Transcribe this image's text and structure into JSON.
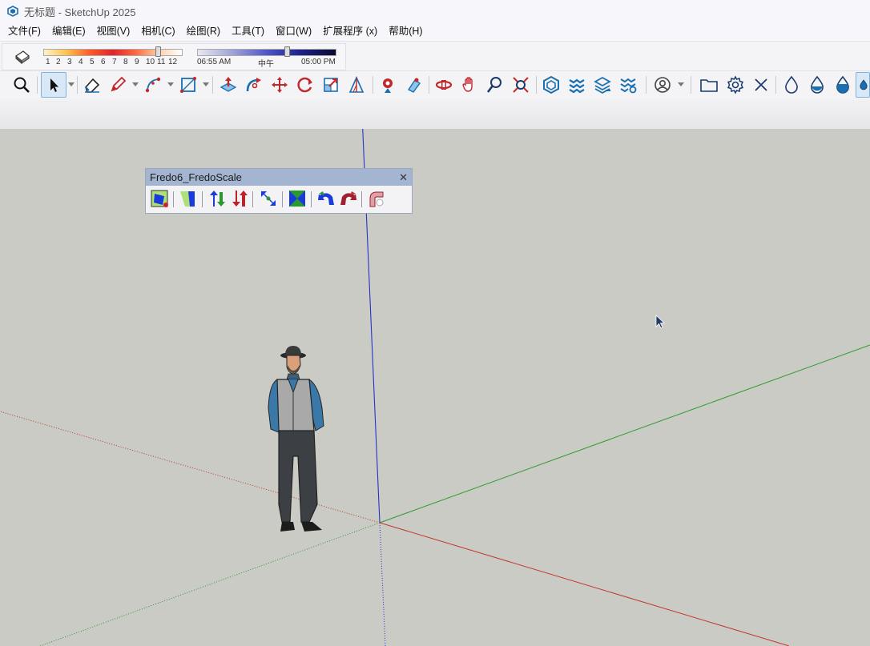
{
  "window": {
    "title": "无标题 - SketchUp 2025",
    "logo_icon": "sketchup-logo-icon"
  },
  "menu": [
    "文件(F)",
    "编辑(E)",
    "视图(V)",
    "相机(C)",
    "绘图(R)",
    "工具(T)",
    "窗口(W)",
    "扩展程序 (x)",
    "帮助(H)"
  ],
  "shadows": {
    "months": [
      "1",
      "2",
      "3",
      "4",
      "5",
      "6",
      "7",
      "8",
      "9",
      "10",
      "11",
      "12"
    ],
    "month_position": 0.83,
    "time_start": "06:55 AM",
    "time_mid": "中午",
    "time_end": "05:00 PM",
    "time_position": 0.65
  },
  "toolbar": {
    "icons": [
      "zoom-icon",
      "select-arrow-icon",
      "eraser-icon",
      "pencil-line-icon",
      "arc-icon",
      "rectangle-icon",
      "push-pull-icon",
      "follow-me-icon",
      "move-icon",
      "rotate-icon",
      "scale-icon",
      "protractor-icon",
      "position-camera-icon",
      "walk-icon",
      "orbit-icon",
      "pan-hand-icon",
      "zoom-window-icon",
      "zoom-extents-icon",
      "3d-warehouse-icon",
      "layers-icon",
      "tags-icon",
      "extension-manager-icon",
      "account-icon",
      "folder-icon",
      "gear-icon",
      "close-icon",
      "water-drop-icon"
    ]
  },
  "fredo_panel": {
    "title": "Fredo6_FredoScale",
    "close": "✕",
    "tools": [
      "box-scale-icon",
      "shear-icon",
      "stretch-up-icon",
      "stretch-down-icon",
      "radial-stretch-icon",
      "tapering-icon",
      "rotate-left-icon",
      "rotate-right-icon",
      "bend-icon"
    ]
  },
  "scene": {
    "figure": "scale-figure-man-with-hat",
    "axis_red": "#c0392b",
    "axis_green": "#2e9a2e",
    "axis_blue": "#2233cc"
  }
}
